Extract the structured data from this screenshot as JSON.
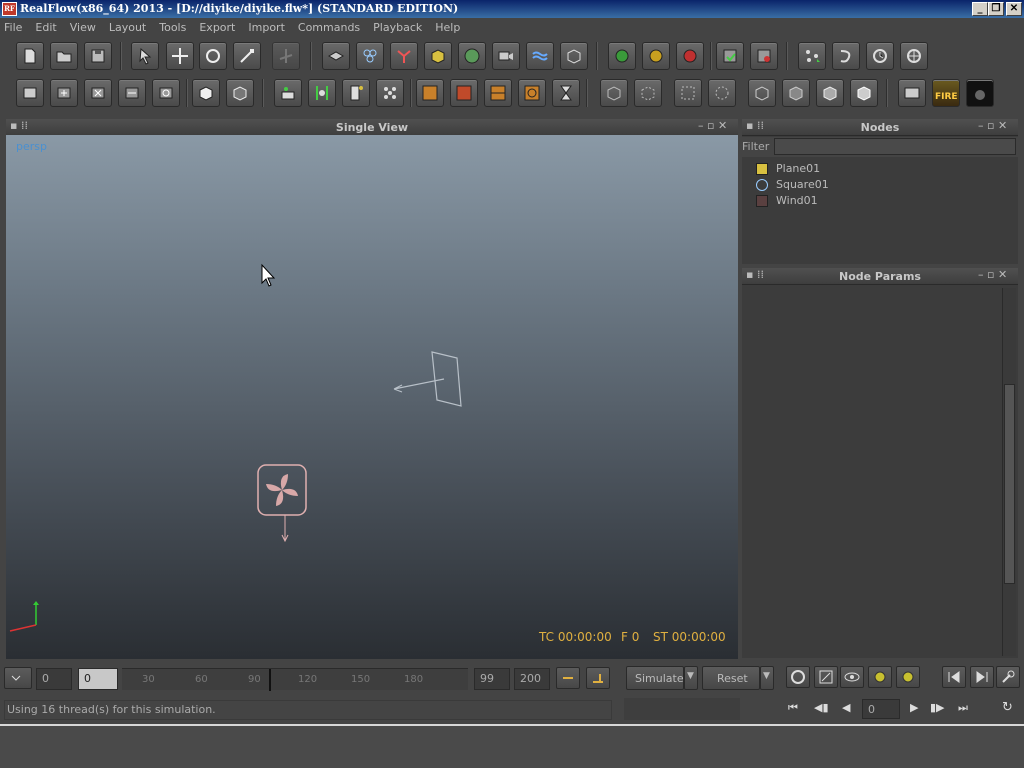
{
  "window": {
    "title": "RealFlow(x86_64) 2013 - [D://diyike/diyike.flw*] (STANDARD EDITION)",
    "app_icon_text": "RF",
    "minimize": "_",
    "maximize": "❐",
    "close": "✕"
  },
  "menu": [
    "File",
    "Edit",
    "View",
    "Layout",
    "Tools",
    "Export",
    "Import",
    "Commands",
    "Playback",
    "Help"
  ],
  "viewport": {
    "title": "Single View",
    "camera_label": "persp",
    "tc_label": "TC 00:00:00",
    "frame_label": "F 0",
    "st_label": "ST 00:00:00"
  },
  "nodes_panel": {
    "title": "Nodes",
    "filter_label": "Filter",
    "filter_value": "",
    "items": [
      {
        "label": "Plane01",
        "icon": "plane-icon"
      },
      {
        "label": "Square01",
        "icon": "emitter-icon"
      },
      {
        "label": "Wind01",
        "icon": "wind-icon"
      }
    ]
  },
  "params_panel": {
    "title": "Node Params"
  },
  "timeline": {
    "start_value": "0",
    "current_value": "0",
    "ticks": [
      "30",
      "60",
      "90",
      "120",
      "150",
      "180"
    ],
    "end_value": "99",
    "max_value": "200"
  },
  "simulation": {
    "simulate_label": "Simulate",
    "reset_label": "Reset",
    "frame_value": "0"
  },
  "status": {
    "message": "Using 16 thread(s) for this simulation."
  },
  "colors": {
    "fire_label": "FIRE",
    "accent_tc": "#e0b040"
  }
}
